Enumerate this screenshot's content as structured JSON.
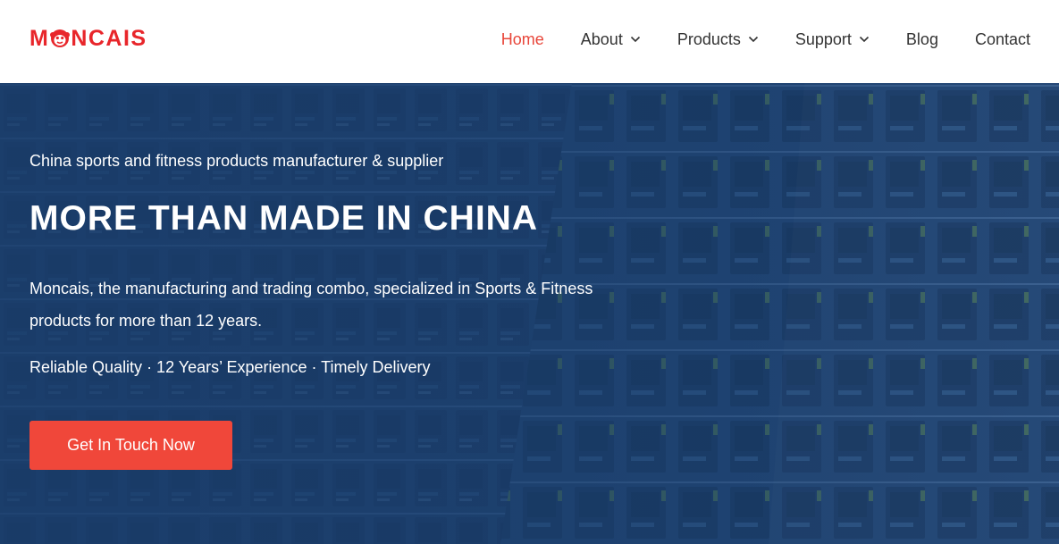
{
  "brand": {
    "logo_text": "MONCAIS",
    "logo_color": "#e8262b"
  },
  "nav": {
    "items": [
      {
        "label": "Home",
        "active": true,
        "dropdown": false
      },
      {
        "label": "About",
        "active": false,
        "dropdown": true
      },
      {
        "label": "Products",
        "active": false,
        "dropdown": true
      },
      {
        "label": "Support",
        "active": false,
        "dropdown": true
      },
      {
        "label": "Blog",
        "active": false,
        "dropdown": false
      },
      {
        "label": "Contact",
        "active": false,
        "dropdown": false
      }
    ],
    "active_color": "#e8463a",
    "text_color": "#333333",
    "dropdown_icon": "chevron-down-icon"
  },
  "hero": {
    "tagline": "China sports and fitness products manufacturer & supplier",
    "headline": "MORE THAN MADE IN CHINA",
    "description": "Moncais, the manufacturing and trading combo, specialized in Sports & Fitness products for more than 12 years.",
    "features": "Reliable Quality · 12 Years’ Experience · Timely Delivery",
    "cta_label": "Get In Touch Now",
    "cta_color": "#f0473a",
    "overlay_color": "#1f3f6c"
  }
}
